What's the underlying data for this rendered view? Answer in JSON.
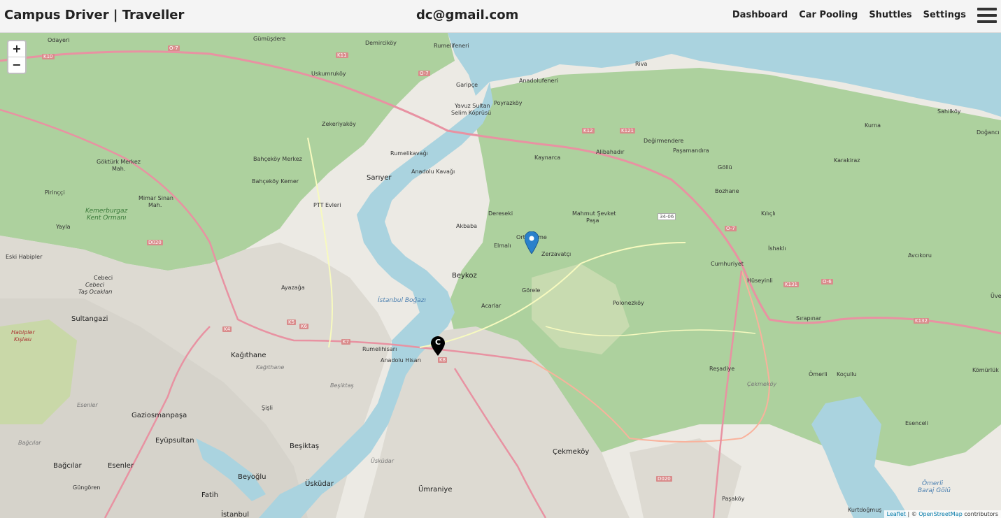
{
  "navbar": {
    "brand": "Campus Driver | Traveller",
    "email": "dc@gmail.com",
    "links": [
      "Dashboard",
      "Car Pooling",
      "Shuttles",
      "Settings"
    ]
  },
  "map": {
    "zoom_in": "+",
    "zoom_out": "−",
    "marker_label": "C",
    "attribution": {
      "leaflet": "Leaflet",
      "sep": " | © ",
      "osm": "OpenStreetMap",
      "suffix": " contributors"
    },
    "labels": {
      "gumusdere": "Gümüşdere",
      "odayeri": "Odayeri",
      "demirciköy": "Demirciköy",
      "rumelifeneri": "Rumelifeneri",
      "uskumrukoy": "Uskumruköy",
      "garipce": "Garipçe",
      "anadolufeneri": "Anadolufeneri",
      "riva": "Riva",
      "poyrazkoy": "Poyrazköy",
      "bridge1": "Yavuz Sultan",
      "bridge2": "Selim Köprüsü",
      "zekeriyakoy": "Zekeriyaköy",
      "rumelikavagi": "Rumelikavağı",
      "anadolukavagi": "Anadolu Kavağı",
      "kaynarca": "Kaynarca",
      "alibahadir": "Alibahadır",
      "degirmendere": "Değirmendere",
      "pasamandira": "Paşamandıra",
      "gollu": "Göllü",
      "kurna": "Kurna",
      "sahilkoy": "Sahilköy",
      "doganci": "Doğancı",
      "karakiraz": "Karakiraz",
      "bozhane": "Bozhane",
      "gokturk": "Göktürk Merkez",
      "gokturk2": "Mah.",
      "bahcekoy_merkez": "Bahçeköy Merkez",
      "bahcekoy_kemer": "Bahçeköy Kemer",
      "sariyer": "Sarıyer",
      "ptt": "PTT Evleri",
      "pirincci": "Pirinççi",
      "mimarsinan": "Mimar Sinan",
      "mimarsinan2": "Mah.",
      "kemerburgaz": "Kemerburgaz",
      "kemerburgaz2": "Kent Ormanı",
      "yayla": "Yayla",
      "dereseki": "Dereseki",
      "akbaba": "Akbaba",
      "elmali": "Elmalı",
      "ortakoy_label": "Ortaçeşme",
      "mahmutsevket": "Mahmut Şevket",
      "mahmutsevket2": "Paşa",
      "zerzavatci": "Zerzavatçı",
      "kilicli": "Kılıçlı",
      "ishakli": "İshaklı",
      "avcikoru": "Avcıkoru",
      "cumhuriyet": "Cumhuriyet",
      "huseyinli": "Hüseyinli",
      "eski_habipler": "Eski Habipler",
      "cebeci": "Cebeci",
      "cebeci2": "Cebeci",
      "cebeci3": "Taş Ocakları",
      "ayazaga": "Ayazağa",
      "beykoz": "Beykoz",
      "gorele": "Görele",
      "acarlar": "Acarlar",
      "polonezkoy": "Polonezköy",
      "bogaz": "İstanbul Boğazı",
      "sirapinar": "Sırapınar",
      "uveys": "Üve",
      "sultangazi": "Sultangazi",
      "habipler": "Habipler",
      "habipler2": "Kışlası",
      "kagithane": "Kağıthane",
      "kagithane_w": "Kağıthane",
      "rumelihisari": "Rumelihisarı",
      "anadoluhisari": "Anadolu Hisarı",
      "besiktas_w": "Beşiktaş",
      "sisli": "Şişli",
      "resadiye": "Reşadiye",
      "omerli": "Ömerli",
      "kocullu": "Koçullu",
      "komurluk": "Kömürlük",
      "cekmekoy_w": "Çekmeköy",
      "esenceli": "Esenceli",
      "gaziosmanpasa": "Gaziosmanpaşa",
      "esenler": "Esenler",
      "eyupsultan": "Eyüpsultan",
      "besiktas": "Beşiktaş",
      "bagcilar_w": "Bağcılar",
      "bagcilar": "Bağcılar",
      "esenler2": "Esenler",
      "gungoren": "Güngören",
      "beyoglu": "Beyoğlu",
      "uskudar": "Üsküdar",
      "uskudar_w": "Üsküdar",
      "umraniye": "Ümraniye",
      "cekmekoy": "Çekmeköy",
      "fatih": "Fatih",
      "istanbul": "İstanbul",
      "pasakoy": "Paşaköy",
      "kurtdogmus": "Kurtdoğmuş",
      "omerli_baraj": "Ömerli",
      "omerli_baraj2": "Baraj Gölü"
    },
    "roads": {
      "o7a": "O-7",
      "o7b": "O-7",
      "o7c": "O-7",
      "o6": "O-6",
      "k12": "K12",
      "k121": "K121",
      "k131": "K131",
      "k132": "K132",
      "d020a": "D020",
      "d020b": "D020",
      "r3406": "34-06",
      "k11": "K11",
      "k10": "K10",
      "k8": "K8",
      "k7": "K7",
      "k6": "K6",
      "k5": "K5",
      "k4": "K4"
    }
  }
}
